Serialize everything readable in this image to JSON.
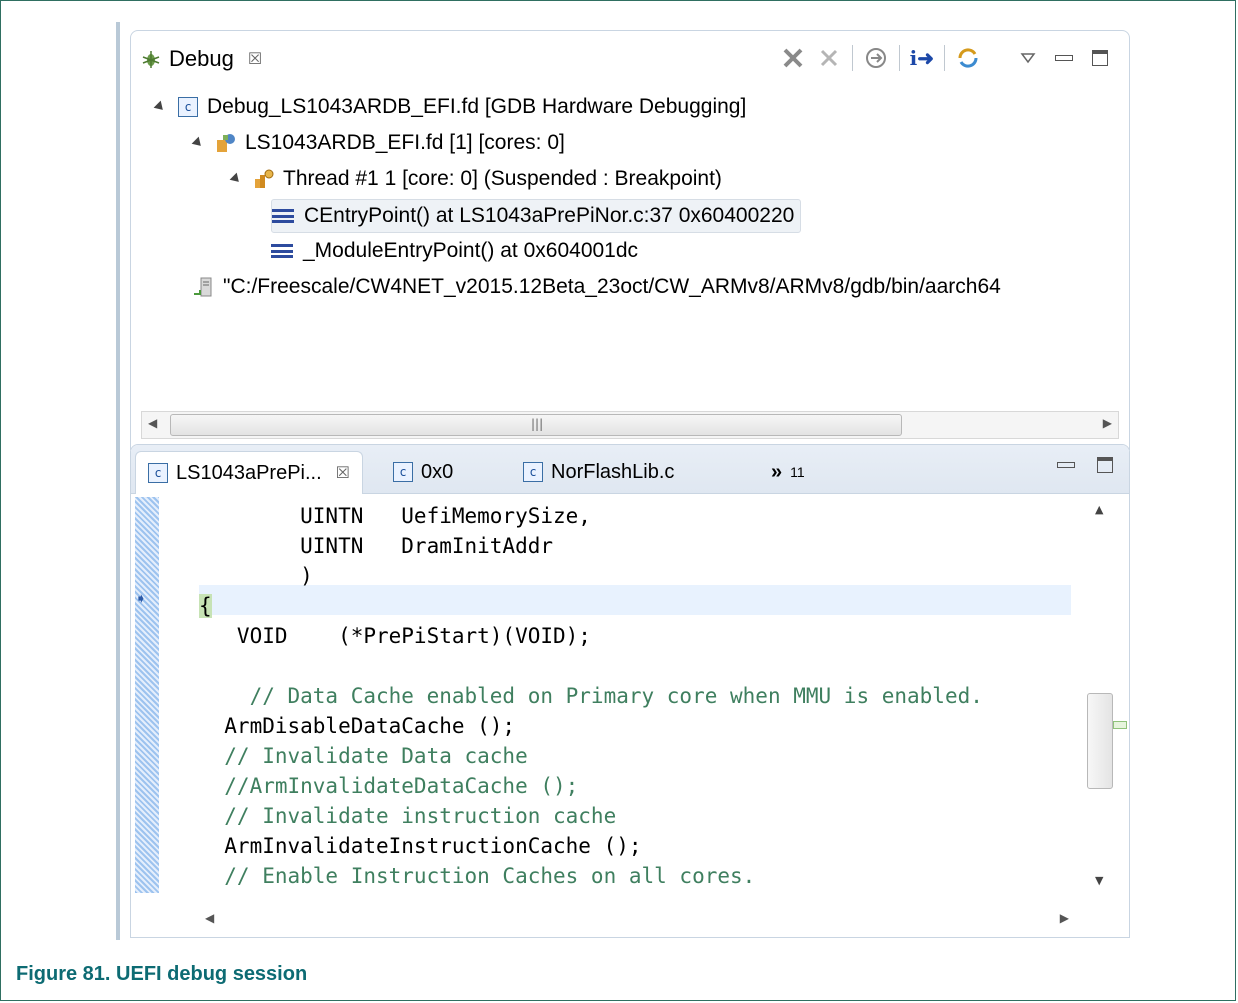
{
  "debug_view": {
    "tab_label": "Debug",
    "tree": [
      {
        "label": "Debug_LS1043ARDB_EFI.fd [GDB Hardware Debugging]",
        "icon": "c-launch-icon"
      },
      {
        "label": "LS1043ARDB_EFI.fd [1] [cores: 0]",
        "icon": "process-icon"
      },
      {
        "label": "Thread #1 1 [core: 0] (Suspended : Breakpoint)",
        "icon": "thread-icon"
      },
      {
        "label": "CEntryPoint() at LS1043aPrePiNor.c:37 0x60400220",
        "icon": "stack-frame-icon"
      },
      {
        "label": "_ModuleEntryPoint() at 0x604001dc",
        "icon": "stack-frame-icon"
      },
      {
        "label": "\"C:/Freescale/CW4NET_v2015.12Beta_23oct/CW_ARMv8/ARMv8/gdb/bin/aarch64",
        "icon": "gdb-process-icon"
      }
    ],
    "toolbar": {
      "step_into_label": "i➜"
    }
  },
  "editor": {
    "tabs": [
      {
        "label": "LS1043aPrePi...",
        "icon": "c-file-icon",
        "active": true
      },
      {
        "label": "0x0",
        "icon": "c-file-icon"
      },
      {
        "label": "NorFlashLib.c",
        "icon": "c-file-icon"
      }
    ],
    "overflow": {
      "chevron": "»",
      "count": "11"
    },
    "code_lines": [
      "        UINTN   UefiMemorySize,",
      "        UINTN   DramInitAddr",
      "        )",
      "{",
      "   VOID    (*PrePiStart)(VOID);",
      "",
      "    // Data Cache enabled on Primary core when MMU is enabled.",
      "  ArmDisableDataCache ();",
      "  // Invalidate Data cache",
      "  //ArmInvalidateDataCache ();",
      "  // Invalidate instruction cache",
      "  ArmInvalidateInstructionCache ();",
      "  // Enable Instruction Caches on all cores."
    ]
  },
  "caption": "Figure 81.  UEFI debug session"
}
